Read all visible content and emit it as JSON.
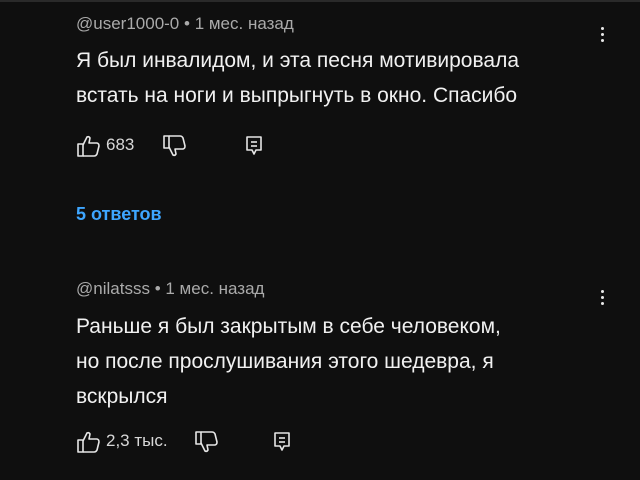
{
  "comments": [
    {
      "author": "@user1000-0",
      "time": "1 мес. назад",
      "text_lines": [
        "Я был инвалидом, и эта песня мотивировала",
        "встать на ноги и выпрыгнуть в окно. Спасибо"
      ],
      "likes": "683",
      "replies_label": "5 ответов"
    },
    {
      "author": "@nilatsss",
      "time": "1 мес. назад",
      "text_lines": [
        "Раньше я был закрытым в себе человеком,",
        "но после прослушивания этого шедевра, я",
        "вскрылся"
      ],
      "likes": "2,3 тыс."
    }
  ],
  "separator": "•",
  "colors": {
    "background": "#0f0f0f",
    "text": "#f1f1f1",
    "meta": "#aaaaaa",
    "link": "#3ea6ff"
  },
  "icons": {
    "like": "thumbs-up-icon",
    "dislike": "thumbs-down-icon",
    "reply": "reply-icon",
    "menu": "more-vert-icon"
  }
}
